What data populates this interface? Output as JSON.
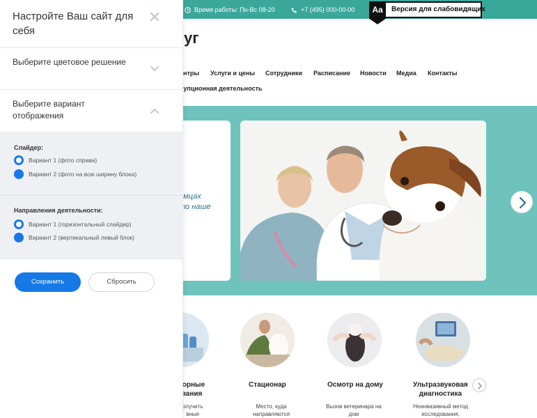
{
  "panel": {
    "title": "Настройте Ваш сайт для себя",
    "sections": [
      {
        "label": "Выберите цветовое решение",
        "expanded": false
      },
      {
        "label": "Выберите вариант отображения",
        "expanded": true
      }
    ],
    "groups": [
      {
        "title": "Слайдер:",
        "options": [
          {
            "label": "Вариант 1 (фото справа)",
            "selected": true
          },
          {
            "label": "Вариант 2 (фото на всю ширину блока)",
            "selected": false
          }
        ]
      },
      {
        "title": "Направления деятельности:",
        "options": [
          {
            "label": "Вариант 1 (горизонтальный слайдер)",
            "selected": true
          },
          {
            "label": "Вариант 2 (вертикальный левый блок)",
            "selected": false
          }
        ]
      }
    ],
    "save_label": "Сохранить",
    "reset_label": "Сбросить"
  },
  "site": {
    "hours": "Время работы: Пн-Вс 08-20",
    "phone": "+7 (495) 000-00-00",
    "a11y_icon": "Aa",
    "a11y_label": "Версия для слабовидящих",
    "title_fragment": "уг",
    "nav": [
      "ентры",
      "Услуги и цены",
      "Сотрудники",
      "Расписание",
      "Новости",
      "Медиа",
      "Контакты"
    ],
    "nav_row2": "рупционная деятельность",
    "hero_text": "омцах\nто наше",
    "services": [
      {
        "title": "торные\nвания",
        "desc": "олучить\nвные"
      },
      {
        "title": "Стационар",
        "desc": "Место, куда\nнаправляются"
      },
      {
        "title": "Осмотр на дому",
        "desc": "Вызов ветеринара на\nдом"
      },
      {
        "title": "Ультразвуковая\nдиагностика",
        "desc": "Неинвазивный метод\nисследования,"
      }
    ]
  },
  "colors": {
    "accent": "#1679e6",
    "teal_bar": "#3aa79b",
    "hero_band": "#6ec3bd"
  }
}
